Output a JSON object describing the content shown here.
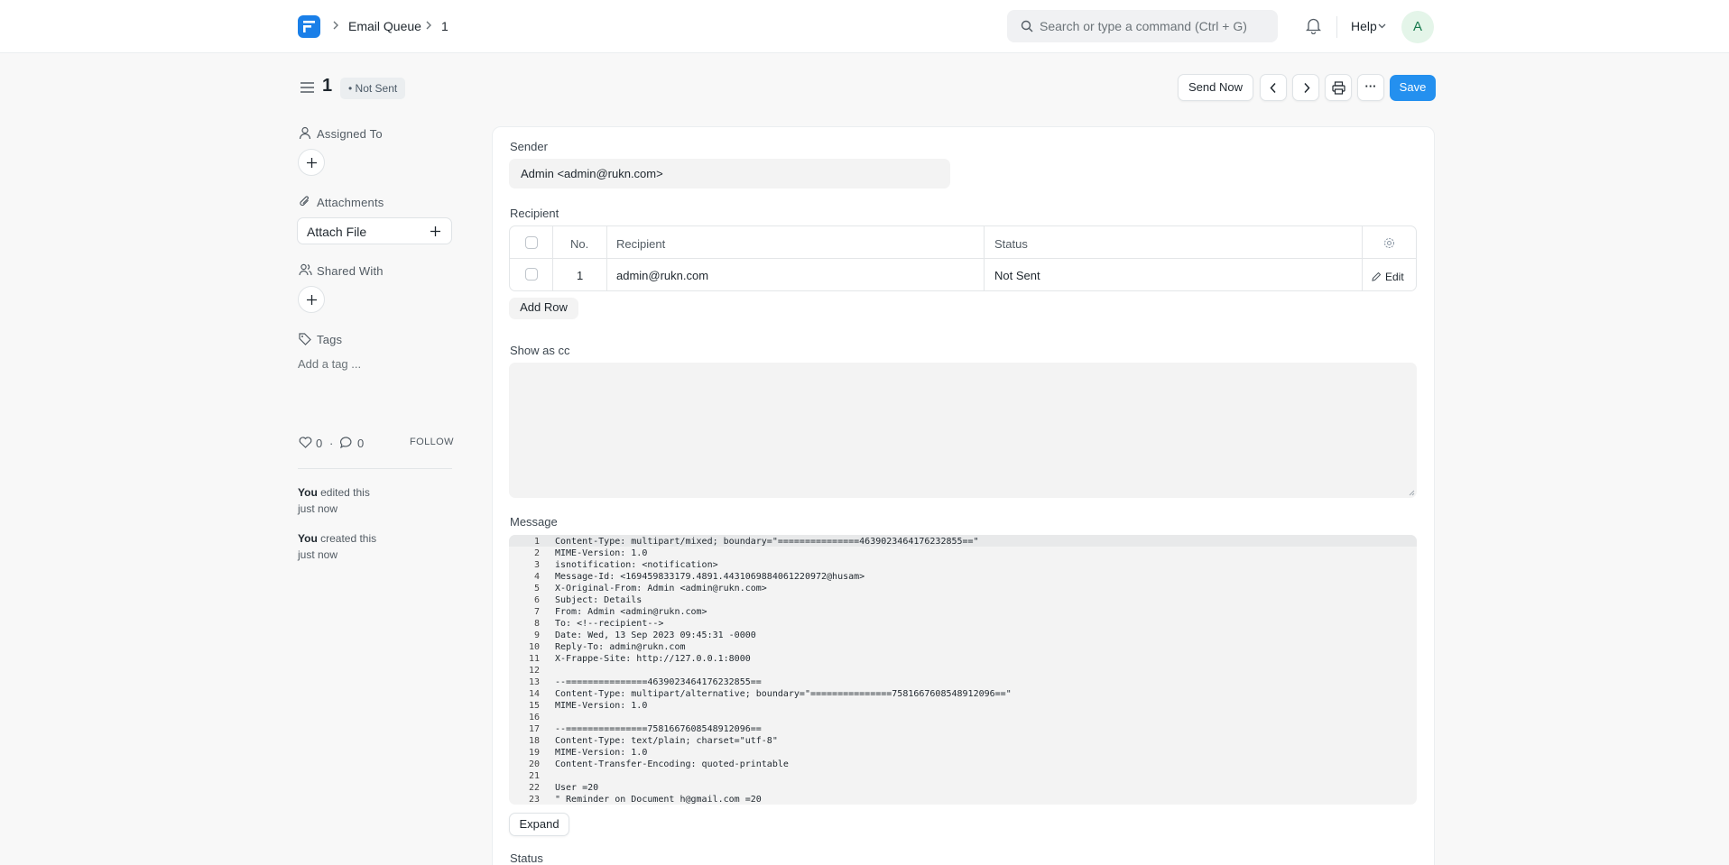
{
  "navbar": {
    "breadcrumbs": [
      "Email Queue",
      "1"
    ],
    "search_placeholder": "Search or type a command (Ctrl + G)",
    "help_label": "Help",
    "avatar_initial": "A"
  },
  "header": {
    "title": "1",
    "status": "Not Sent",
    "send_now_label": "Send Now",
    "more_label": "···",
    "save_label": "Save"
  },
  "sidebar": {
    "assigned_to_label": "Assigned To",
    "attachments_label": "Attachments",
    "attach_file_label": "Attach File",
    "shared_with_label": "Shared With",
    "tags_label": "Tags",
    "add_tag_label": "Add a tag ...",
    "likes_count": "0",
    "comments_count": "0",
    "dot_sep": "·",
    "follow_label": "FOLLOW",
    "activity": [
      {
        "actor": "You",
        "action": " edited this",
        "time": "just now"
      },
      {
        "actor": "You",
        "action": " created this",
        "time": "just now"
      }
    ]
  },
  "form": {
    "sender_label": "Sender",
    "sender_value": "Admin <admin@rukn.com>",
    "recipient_label": "Recipient",
    "recipient_table": {
      "columns": [
        "No.",
        "Recipient",
        "Status"
      ],
      "rows": [
        {
          "no": "1",
          "recipient": "admin@rukn.com",
          "status": "Not Sent"
        }
      ],
      "edit_label": "Edit",
      "add_row_label": "Add Row"
    },
    "show_as_cc_label": "Show as cc",
    "message_label": "Message",
    "message_lines": [
      "Content-Type: multipart/mixed; boundary=\"===============4639023464176232855==\"",
      "MIME-Version: 1.0",
      "isnotification: <notification>",
      "Message-Id: <169459833179.4891.4431069884061220972@husam>",
      "X-Original-From: Admin <admin@rukn.com>",
      "Subject: Details",
      "From: Admin <admin@rukn.com>",
      "To: <!--recipient-->",
      "Date: Wed, 13 Sep 2023 09:45:31 -0000",
      "Reply-To: admin@rukn.com",
      "X-Frappe-Site: http://127.0.0.1:8000",
      "",
      "--===============4639023464176232855==",
      "Content-Type: multipart/alternative; boundary=\"===============7581667608548912096==\"",
      "MIME-Version: 1.0",
      "",
      "--===============7581667608548912096==",
      "Content-Type: text/plain; charset=\"utf-8\"",
      "MIME-Version: 1.0",
      "Content-Transfer-Encoding: quoted-printable",
      "",
      "User =20",
      "\" Reminder on Document h@gmail.com =20"
    ],
    "expand_label": "Expand",
    "status_label": "Status"
  }
}
